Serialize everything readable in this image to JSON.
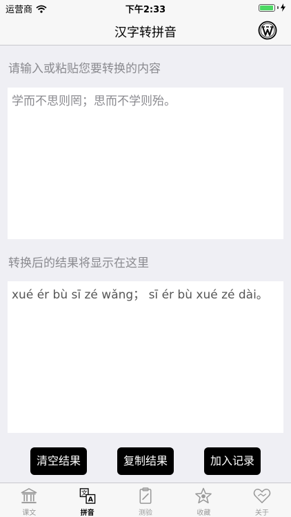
{
  "status_bar": {
    "carrier": "运营商",
    "time": "下午2:33"
  },
  "nav": {
    "title": "汉字转拼音",
    "wp_icon": "wordpress-icon"
  },
  "input_section": {
    "label": "请输入或粘贴您要转换的内容",
    "text": "学而不思则罔；思而不学则殆。"
  },
  "output_section": {
    "label": "转换后的结果将显示在这里",
    "text": "xué ér bù sī zé wǎng；  sī ér bù xué zé dài。"
  },
  "actions": {
    "clear": "清空结果",
    "copy": "复制结果",
    "add": "加入记录"
  },
  "tabs": [
    {
      "label": "课文",
      "icon": "temple-icon"
    },
    {
      "label": "拼音",
      "icon": "translate-icon",
      "active": true
    },
    {
      "label": "测验",
      "icon": "clipboard-icon"
    },
    {
      "label": "收藏",
      "icon": "star-icon"
    },
    {
      "label": "关于",
      "icon": "handshake-icon"
    }
  ],
  "colors": {
    "accent": "#000000",
    "inactive": "#999999",
    "battery": "#4cd964"
  }
}
